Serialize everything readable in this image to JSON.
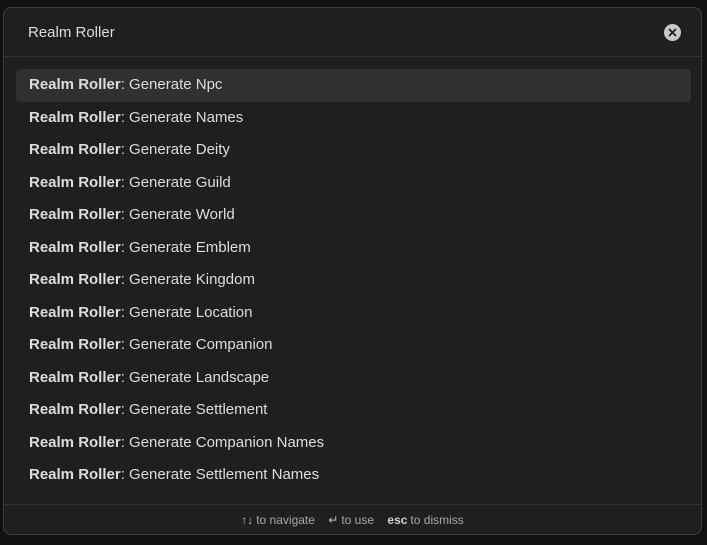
{
  "search": {
    "value": "Realm Roller",
    "clear_icon": "close-circle-icon"
  },
  "results": {
    "selected_index": 0,
    "items": [
      {
        "prefix": "Realm Roller",
        "separator": ": ",
        "label": "Generate Npc"
      },
      {
        "prefix": "Realm Roller",
        "separator": ": ",
        "label": "Generate Names"
      },
      {
        "prefix": "Realm Roller",
        "separator": ": ",
        "label": "Generate Deity"
      },
      {
        "prefix": "Realm Roller",
        "separator": ": ",
        "label": "Generate Guild"
      },
      {
        "prefix": "Realm Roller",
        "separator": ": ",
        "label": "Generate World"
      },
      {
        "prefix": "Realm Roller",
        "separator": ": ",
        "label": "Generate Emblem"
      },
      {
        "prefix": "Realm Roller",
        "separator": ": ",
        "label": "Generate Kingdom"
      },
      {
        "prefix": "Realm Roller",
        "separator": ": ",
        "label": "Generate Location"
      },
      {
        "prefix": "Realm Roller",
        "separator": ": ",
        "label": "Generate Companion"
      },
      {
        "prefix": "Realm Roller",
        "separator": ": ",
        "label": "Generate Landscape"
      },
      {
        "prefix": "Realm Roller",
        "separator": ": ",
        "label": "Generate Settlement"
      },
      {
        "prefix": "Realm Roller",
        "separator": ": ",
        "label": "Generate Companion Names"
      },
      {
        "prefix": "Realm Roller",
        "separator": ": ",
        "label": "Generate Settlement Names"
      }
    ]
  },
  "footer": {
    "navigate_key": "↑↓",
    "navigate_text": "to navigate",
    "use_key": "↵",
    "use_text": "to use",
    "dismiss_key": "esc",
    "dismiss_text": "to dismiss"
  },
  "colors": {
    "background": "#1f1f1f",
    "selected_row": "#303030",
    "text": "#dcddde",
    "muted": "#a8a8a8"
  }
}
